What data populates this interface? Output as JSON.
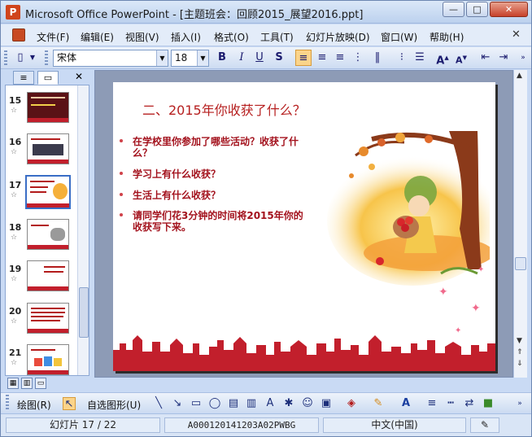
{
  "window": {
    "title": "Microsoft Office PowerPoint - [主题班会：回顾2015_展望2016.ppt]",
    "app_icon_letter": "P",
    "minimize": "—",
    "maximize": "□",
    "close": "✕"
  },
  "menu": {
    "items": [
      "文件(F)",
      "编辑(E)",
      "视图(V)",
      "插入(I)",
      "格式(O)",
      "工具(T)",
      "幻灯片放映(D)",
      "窗口(W)",
      "帮助(H)"
    ],
    "close_doc": "✕"
  },
  "toolbar": {
    "font_name": "宋体",
    "font_size": "18",
    "bold": "B",
    "italic": "I",
    "underline": "U",
    "shadow": "S",
    "active_button": "align-left"
  },
  "pane": {
    "outline_tab": "≡",
    "slides_tab": "▭",
    "close": "✕",
    "thumbnails": [
      {
        "num": "15",
        "star": "☆"
      },
      {
        "num": "16",
        "star": "☆"
      },
      {
        "num": "17",
        "star": "☆",
        "selected": true
      },
      {
        "num": "18",
        "star": "☆"
      },
      {
        "num": "19",
        "star": "☆"
      },
      {
        "num": "20",
        "star": "☆"
      },
      {
        "num": "21",
        "star": "☆"
      }
    ]
  },
  "slide": {
    "title": "二、2015年你收获了什么？",
    "bullets": [
      "在学校里你参加了哪些活动？收获了什么？",
      "学习上有什么收获？",
      "生活上有什么收获？",
      "请同学们花3分钟的时间将2015年你的收获写下来。"
    ],
    "colors": {
      "title": "#b61f1f",
      "bullet": "#a3121d",
      "city": "#c21f2c"
    }
  },
  "drawing_toolbar": {
    "draw_label": "绘图(R)",
    "autoshapes_label": "自选图形(U)"
  },
  "status": {
    "slide_counter": "幻灯片 17 / 22",
    "template": "A000120141203A02PWBG",
    "language": "中文(中国)"
  }
}
